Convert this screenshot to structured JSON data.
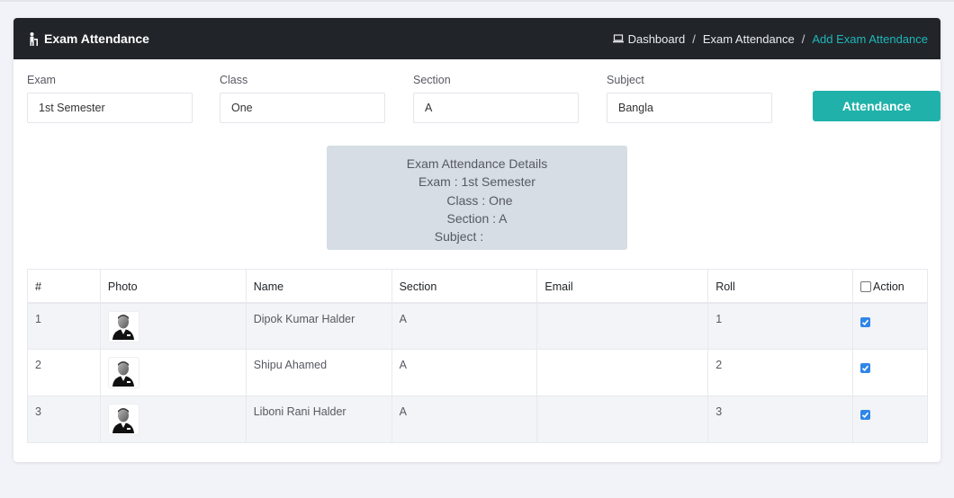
{
  "header": {
    "title": "Exam Attendance",
    "breadcrumb": [
      "Dashboard",
      "Exam Attendance",
      "Add Exam Attendance"
    ]
  },
  "filters": [
    {
      "label": "Exam",
      "value": "1st Semester"
    },
    {
      "label": "Class",
      "value": "One"
    },
    {
      "label": "Section",
      "value": "A"
    },
    {
      "label": "Subject",
      "value": "Bangla"
    }
  ],
  "attendance_button": "Attendance",
  "details": {
    "title": "Exam Attendance Details",
    "exam": "Exam : 1st Semester",
    "class": "Class : One",
    "section": "Section : A",
    "subject": "Subject :"
  },
  "table": {
    "headers": [
      "#",
      "Photo",
      "Name",
      "Section",
      "Email",
      "Roll",
      "Action"
    ],
    "rows": [
      {
        "no": "1",
        "name": "Dipok Kumar Halder",
        "section": "A",
        "email": "",
        "roll": "1",
        "checked": true
      },
      {
        "no": "2",
        "name": "Shipu Ahamed",
        "section": "A",
        "email": "",
        "roll": "2",
        "checked": true
      },
      {
        "no": "3",
        "name": "Liboni Rani Halder",
        "section": "A",
        "email": "",
        "roll": "3",
        "checked": true
      }
    ]
  },
  "colors": {
    "accent": "#20b2aa",
    "header_bg": "#212529",
    "breadcrumb_active": "#1fb7bb",
    "checkbox": "#2f86e8"
  }
}
